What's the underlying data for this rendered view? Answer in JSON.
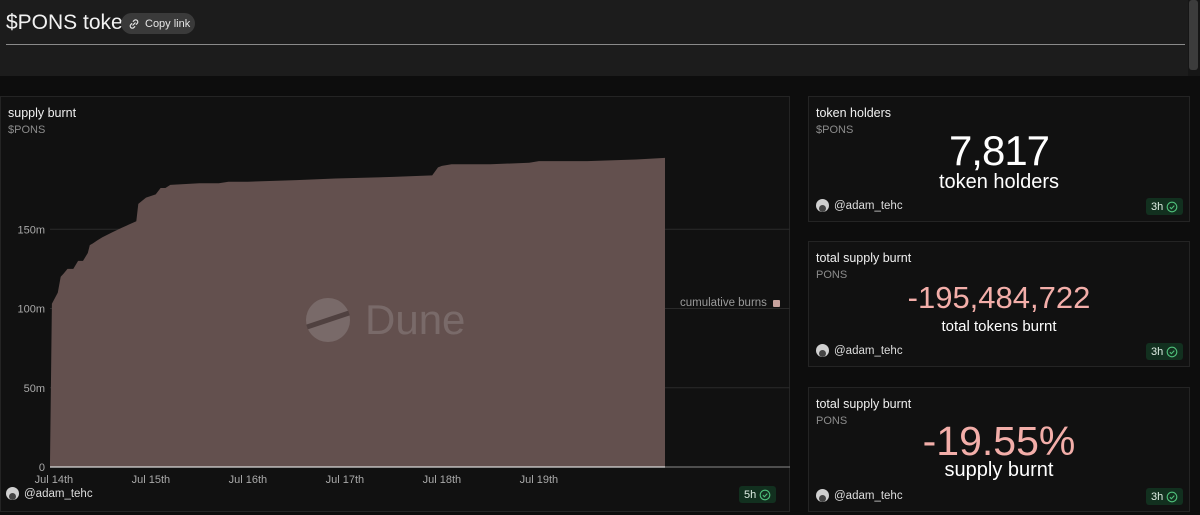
{
  "page": {
    "title": "$PONS token",
    "copy_link_label": "Copy link"
  },
  "supply_burnt": {
    "title": "supply burnt",
    "subtitle": "$PONS",
    "author": "@adam_tehc",
    "age": "5h",
    "watermark": "Dune",
    "legend_label": "cumulative burns"
  },
  "token_holders": {
    "title": "token holders",
    "subtitle": "$PONS",
    "value": "7,817",
    "label": "token holders",
    "author": "@adam_tehc",
    "age": "3h"
  },
  "total_supply_burnt": {
    "title": "total supply burnt",
    "subtitle": "PONS",
    "value": "-195,484,722",
    "label": "total tokens burnt",
    "author": "@adam_tehc",
    "age": "3h"
  },
  "pct_supply_burnt": {
    "title": "total supply burnt",
    "subtitle": "PONS",
    "value": "-19.55%",
    "label": "supply burnt",
    "author": "@adam_tehc",
    "age": "3h"
  },
  "colors": {
    "area_fill": "#63504e",
    "number_red": "#f3aea9",
    "accent_green": "#4fbf7a"
  },
  "chart_data": {
    "type": "area",
    "x_tick_labels": [
      "Jul 14th",
      "Jul 15th",
      "Jul 16th",
      "Jul 17th",
      "Jul 18th",
      "Jul 19th"
    ],
    "y_tick_labels": [
      "0",
      "50m",
      "100m",
      "150m"
    ],
    "ylim": [
      0,
      200
    ],
    "y_unit": "m",
    "xlim": [
      13.96,
      20.3
    ],
    "grid": true,
    "legend_position": "right",
    "series": [
      {
        "name": "cumulative burns",
        "x": [
          13.96,
          13.98,
          14.04,
          14.07,
          14.1,
          14.14,
          14.2,
          14.25,
          14.3,
          14.35,
          14.37,
          14.4,
          14.45,
          14.5,
          14.6,
          14.7,
          14.85,
          14.87,
          14.95,
          15.05,
          15.1,
          15.15,
          15.2,
          15.5,
          15.7,
          15.8,
          16.0,
          16.5,
          16.9,
          17.5,
          17.9,
          17.96,
          18.0,
          18.1,
          18.5,
          18.9,
          19.0,
          19.5,
          20.0,
          20.3
        ],
        "y": [
          3,
          103,
          110,
          120,
          122,
          125,
          125,
          130,
          130,
          135,
          140,
          141,
          143,
          145,
          148,
          151,
          155,
          166,
          170,
          172,
          176,
          176,
          178,
          179,
          179,
          180,
          180,
          181,
          182,
          183,
          184,
          189,
          190,
          191,
          191,
          192,
          193,
          193,
          194,
          195
        ]
      }
    ]
  }
}
